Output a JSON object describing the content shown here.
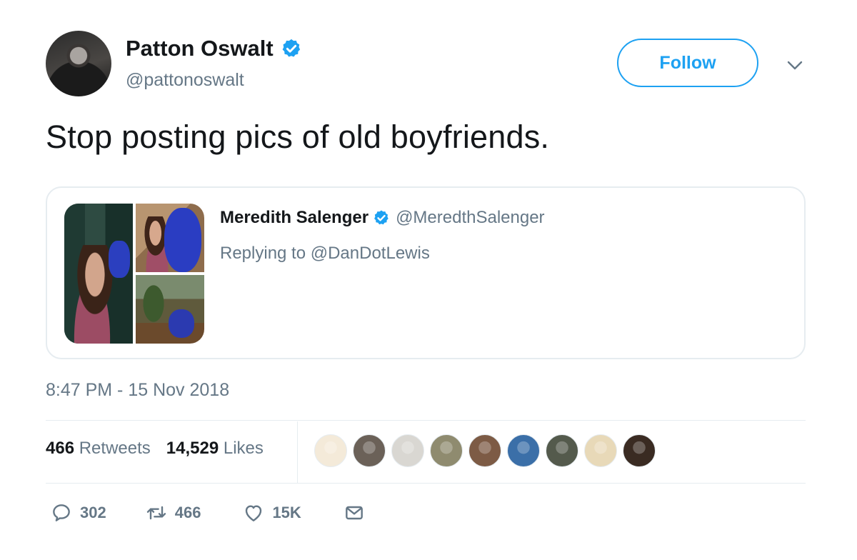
{
  "author": {
    "name": "Patton Oswalt",
    "handle": "@pattonoswalt",
    "verified": true
  },
  "follow_button": {
    "label": "Follow"
  },
  "tweet": {
    "text": "Stop posting pics of old boyfriends.",
    "timestamp": "8:47 PM - 15 Nov 2018"
  },
  "quoted_tweet": {
    "name": "Meredith Salenger",
    "handle": "@MeredthSalenger",
    "verified": true,
    "replying_to": "Replying to @DanDotLewis"
  },
  "stats": {
    "retweets_count": "466",
    "retweets_label": "Retweets",
    "likes_count": "14,529",
    "likes_label": "Likes"
  },
  "liker_avatars": [
    {
      "icon": "liker-avatar-1",
      "color": "#f4ead9"
    },
    {
      "icon": "liker-avatar-2",
      "color": "#6b6158"
    },
    {
      "icon": "liker-avatar-3",
      "color": "#d9d7d2"
    },
    {
      "icon": "liker-avatar-4",
      "color": "#8f8b6f"
    },
    {
      "icon": "liker-avatar-5",
      "color": "#7d5b45"
    },
    {
      "icon": "liker-avatar-6",
      "color": "#3b6fa8"
    },
    {
      "icon": "liker-avatar-7",
      "color": "#545a4c"
    },
    {
      "icon": "liker-avatar-8",
      "color": "#e8d9b8"
    },
    {
      "icon": "liker-avatar-9",
      "color": "#3a2b22"
    }
  ],
  "actions": {
    "reply_count": "302",
    "retweet_count": "466",
    "like_count": "15K"
  },
  "colors": {
    "accent": "#1da1f2",
    "secondary_text": "#657786",
    "border": "#e6ecf0"
  }
}
